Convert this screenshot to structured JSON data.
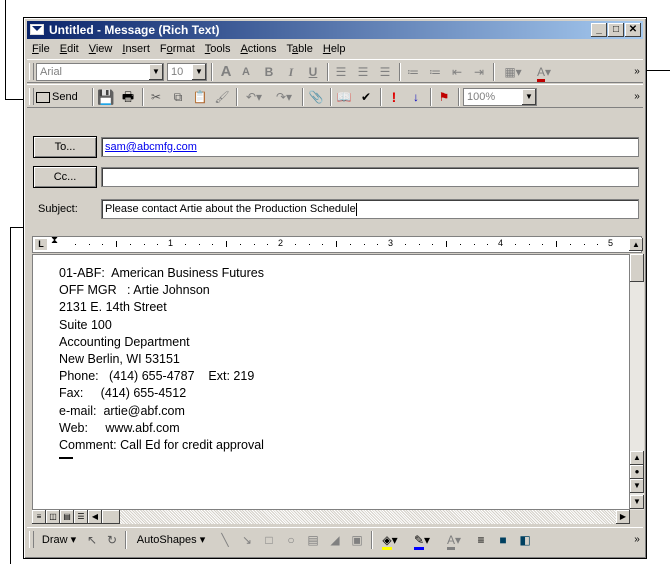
{
  "window": {
    "title": "Untitled - Message (Rich Text)"
  },
  "menu": [
    {
      "label": "File",
      "u": "F",
      "rest": "ile"
    },
    {
      "label": "Edit",
      "u": "E",
      "rest": "dit"
    },
    {
      "label": "View",
      "u": "V",
      "rest": "iew"
    },
    {
      "label": "Insert",
      "u": "I",
      "rest": "nsert"
    },
    {
      "label": "Format",
      "pre": "F",
      "u": "o",
      "rest": "rmat"
    },
    {
      "label": "Tools",
      "u": "T",
      "rest": "ools"
    },
    {
      "label": "Actions",
      "u": "A",
      "rest": "ctions"
    },
    {
      "label": "Table",
      "pre": "T",
      "u": "a",
      "rest": "ble"
    },
    {
      "label": "Help",
      "u": "H",
      "rest": "elp"
    }
  ],
  "format_toolbar": {
    "font": "Arial",
    "size": "10"
  },
  "standard_toolbar": {
    "send_label": "Send",
    "zoom": "100%"
  },
  "header": {
    "to_button": "To...",
    "cc_button": "Cc...",
    "subject_label": "Subject:",
    "to_value": "sam@abcmfg.com",
    "cc_value": "",
    "subject_value": "Please contact Artie about the Production Schedule"
  },
  "ruler": {
    "marks": [
      "1",
      "2",
      "3",
      "4",
      "5"
    ]
  },
  "body_lines": [
    "01-ABF:  American Business Futures",
    "OFF MGR   : Artie Johnson",
    "2131 E. 14th Street",
    "Suite 100",
    "Accounting Department",
    "New Berlin, WI 53151",
    "Phone:   (414) 655-4787    Ext: 219",
    "Fax:     (414) 655-4512",
    "e-mail:  artie@abf.com",
    "Web:     www.abf.com",
    "Comment: Call Ed for credit approval"
  ],
  "drawing_toolbar": {
    "draw_label": "Draw",
    "autoshapes_label": "AutoShapes"
  },
  "colors": {
    "titlebar_start": "#0a246a",
    "titlebar_end": "#a6caf0",
    "chrome": "#d4d0c8"
  }
}
